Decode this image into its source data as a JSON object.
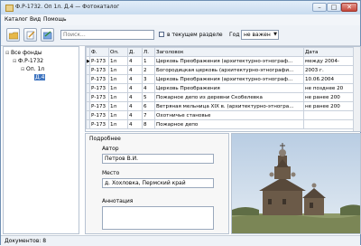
{
  "window": {
    "title": "Ф.Р-1732. Оп 1л. Д.4 — Фотокаталог"
  },
  "menu": [
    "Каталог",
    "Вид",
    "Помощь"
  ],
  "toolbar": {
    "search_placeholder": "Поиск...",
    "in_section_label": "в текущем разделе",
    "in_section_checked": false,
    "year_label": "Год",
    "year_value": "не важен"
  },
  "tree": {
    "root": "Все фонды",
    "fund": "Ф.Р-1732",
    "inventory": "Оп. 1л",
    "file": "Д.4"
  },
  "table": {
    "columns": [
      "Ф.",
      "Оп.",
      "Д.",
      "Л.",
      "Заголовок",
      "Дата"
    ],
    "rows": [
      [
        "Р-173",
        "1л",
        "4",
        "1",
        "Церковь Преображения (архитектурно-этнограф...",
        "между 2004-"
      ],
      [
        "Р-173",
        "1л",
        "4",
        "2",
        "Богородицкая церковь (архитектурно-этнографи...",
        "2003 г."
      ],
      [
        "Р-173",
        "1л",
        "4",
        "3",
        "Церковь Преображения (архитектурно-этнограф...",
        "10.06.2004"
      ],
      [
        "Р-173",
        "1л",
        "4",
        "4",
        "Церковь Преображения",
        "не позднее 20"
      ],
      [
        "Р-173",
        "1л",
        "4",
        "5",
        "Пожарное депо из деревни Скобелевка",
        "не ранее 200"
      ],
      [
        "Р-173",
        "1л",
        "4",
        "6",
        "Ветряная мельница XIX в. (архитектурно-этногра...",
        "не ранее 200"
      ],
      [
        "Р-173",
        "1л",
        "4",
        "7",
        "Охотничье становье",
        ""
      ],
      [
        "Р-173",
        "1л",
        "4",
        "8",
        "Пожарное депо",
        ""
      ]
    ],
    "active_row": 0
  },
  "details": {
    "title": "Подробнее",
    "author_label": "Автор",
    "author_value": "Петров В.И.",
    "place_label": "Место",
    "place_value": "д. Хохловка, Пермский край",
    "annotation_label": "Аннотация",
    "annotation_value": ""
  },
  "status": {
    "text": "Документов: 8"
  }
}
